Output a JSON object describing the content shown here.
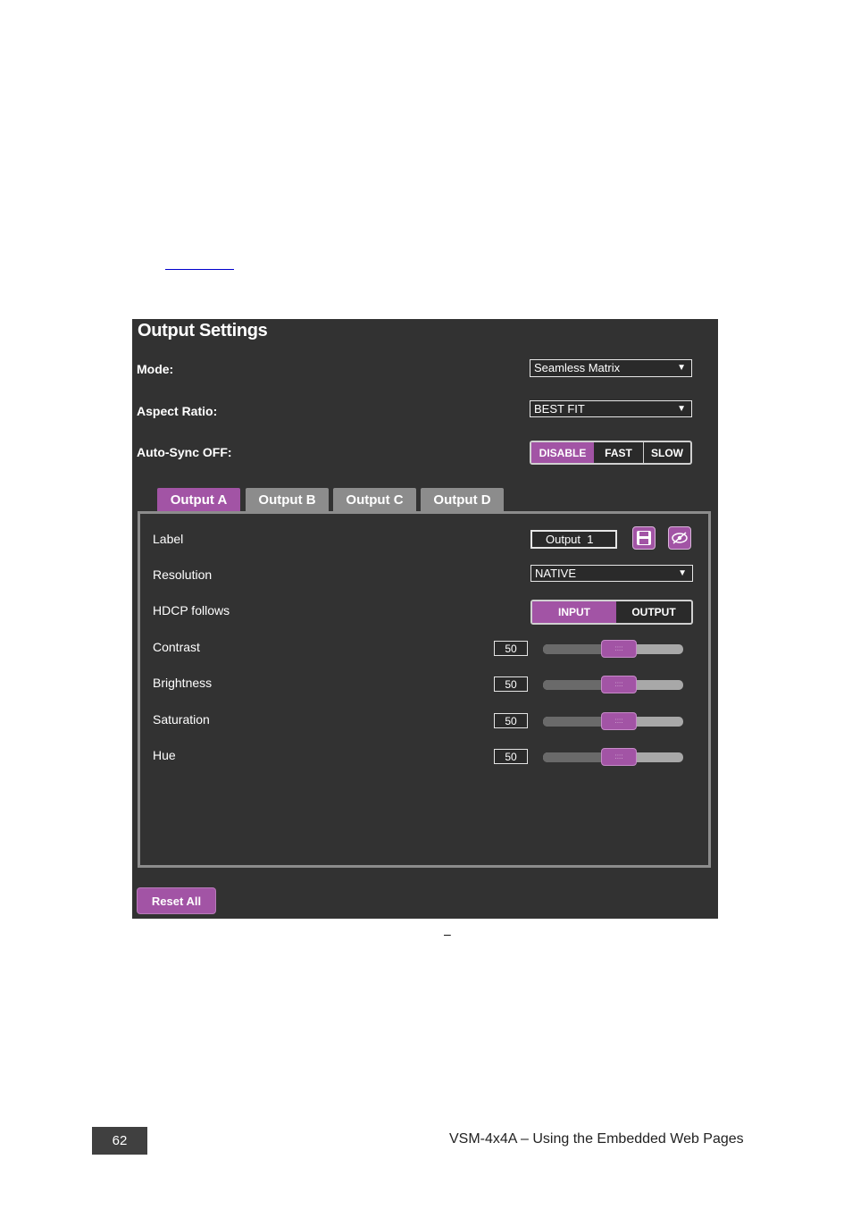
{
  "panel": {
    "title": "Output Settings",
    "mode": {
      "label": "Mode:",
      "value": "Seamless Matrix"
    },
    "aspect_ratio": {
      "label": "Aspect Ratio:",
      "value": "BEST FIT"
    },
    "auto_sync": {
      "label": "Auto-Sync OFF:",
      "options": [
        "DISABLE",
        "FAST",
        "SLOW"
      ],
      "selected": "DISABLE"
    },
    "tabs": [
      {
        "label": "Output A",
        "active": true
      },
      {
        "label": "Output B",
        "active": false
      },
      {
        "label": "Output C",
        "active": false
      },
      {
        "label": "Output D",
        "active": false
      }
    ],
    "output": {
      "label": {
        "label": "Label",
        "value": "Output  1"
      },
      "resolution": {
        "label": "Resolution",
        "value": "NATIVE"
      },
      "hdcp": {
        "label": "HDCP follows",
        "options": [
          "INPUT",
          "OUTPUT"
        ],
        "selected": "INPUT"
      },
      "sliders": [
        {
          "label": "Contrast",
          "value": "50"
        },
        {
          "label": "Brightness",
          "value": "50"
        },
        {
          "label": "Saturation",
          "value": "50"
        },
        {
          "label": "Hue",
          "value": "50"
        }
      ]
    },
    "reset_label": "Reset All"
  },
  "caption": {
    "dash": "–"
  },
  "footer": {
    "page_number": "62",
    "text": "VSM-4x4A – Using the Embedded Web Pages"
  },
  "colors": {
    "accent": "#a254a5",
    "panel_bg": "#323232",
    "tab_inactive": "#8c8c8c"
  }
}
